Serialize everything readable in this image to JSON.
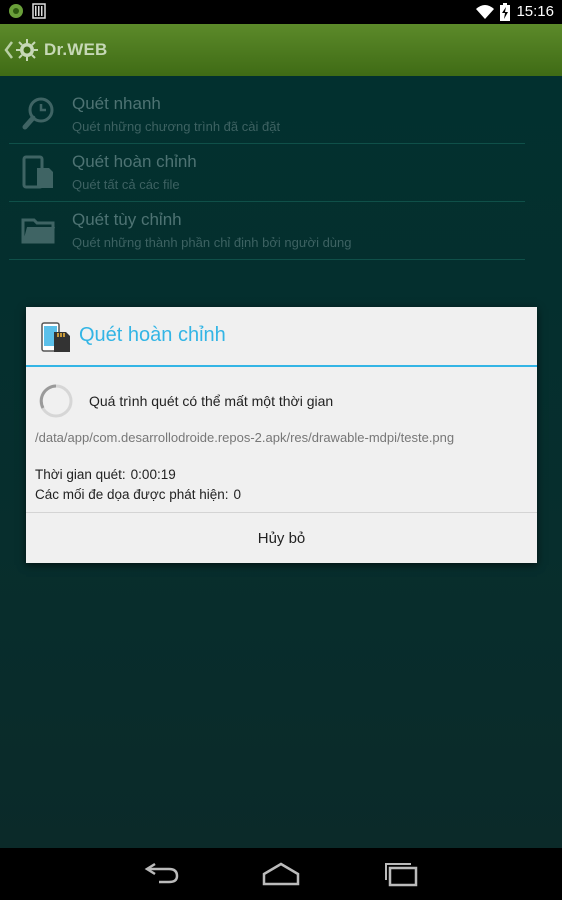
{
  "status_bar": {
    "time": "15:16"
  },
  "app": {
    "title": "Dr.WEB"
  },
  "menu": [
    {
      "title": "Quét nhanh",
      "subtitle": "Quét những chương trình đã cài đặt",
      "icon": "clock-search-icon"
    },
    {
      "title": "Quét hoàn chỉnh",
      "subtitle": "Quét tất cả các file",
      "icon": "phone-sdcard-icon"
    },
    {
      "title": "Quét tùy chỉnh",
      "subtitle": "Quét những thành phần chỉ định bởi người dùng",
      "icon": "folder-icon"
    }
  ],
  "dialog": {
    "title": "Quét hoàn chỉnh",
    "message": "Quá trình quét có thể mất một thời gian",
    "current_file": "/data/app/com.desarrollodroide.repos-2.apk/res/drawable-mdpi/teste.png",
    "scan_time_label": "Thời gian quét:",
    "scan_time_value": "0:00:19",
    "threats_label": "Các mối đe dọa được phát hiện:",
    "threats_value": "0",
    "cancel_label": "Hủy bỏ"
  },
  "colors": {
    "accent": "#33b5e5",
    "action_bar": "#4c7a1f",
    "background": "#02302f"
  }
}
